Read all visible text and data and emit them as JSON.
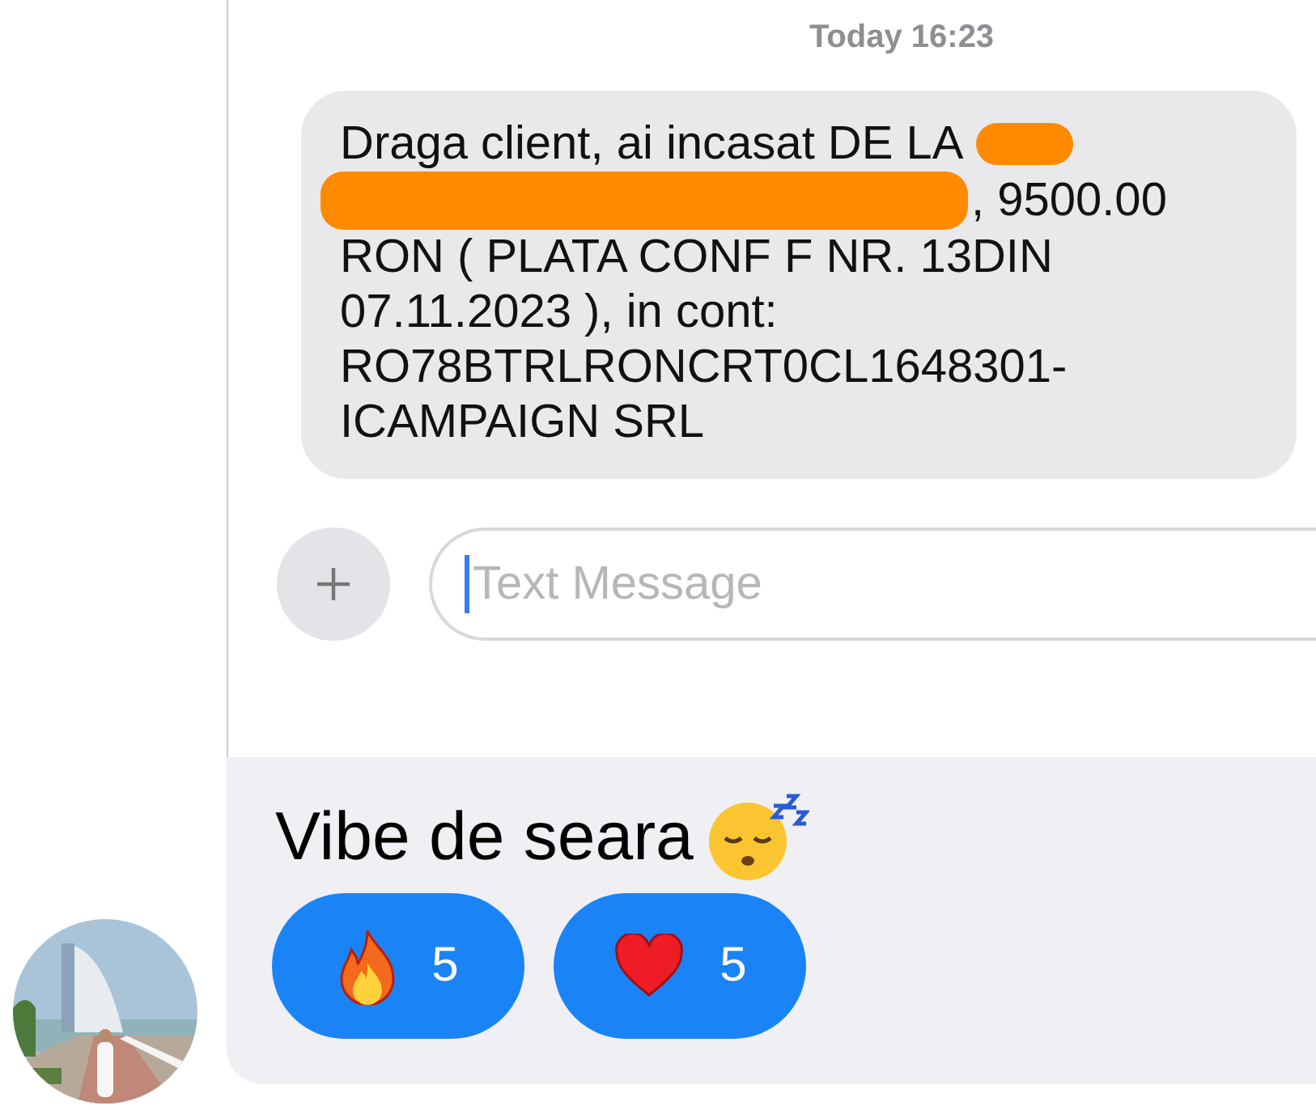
{
  "shared_screenshot": {
    "timestamp": "Today 16:23",
    "message_lines": [
      {
        "text": "Draga client, ai incasat DE LA",
        "redacted_end": true
      },
      {
        "text": ", 9500.00",
        "redacted_start": true
      },
      {
        "text": "RON ( PLATA CONF F NR. 13DIN"
      },
      {
        "text": "07.11.2023 ), in cont:"
      },
      {
        "text": "RO78BTRLRONCRT0CL1648301-"
      },
      {
        "text": "ICAMPAIGN SRL"
      }
    ],
    "composer": {
      "placeholder": "Text Message"
    }
  },
  "post": {
    "caption": "Vibe de seara",
    "reactions": [
      {
        "kind": "fire",
        "count": "5"
      },
      {
        "kind": "heart",
        "count": "5"
      }
    ]
  }
}
